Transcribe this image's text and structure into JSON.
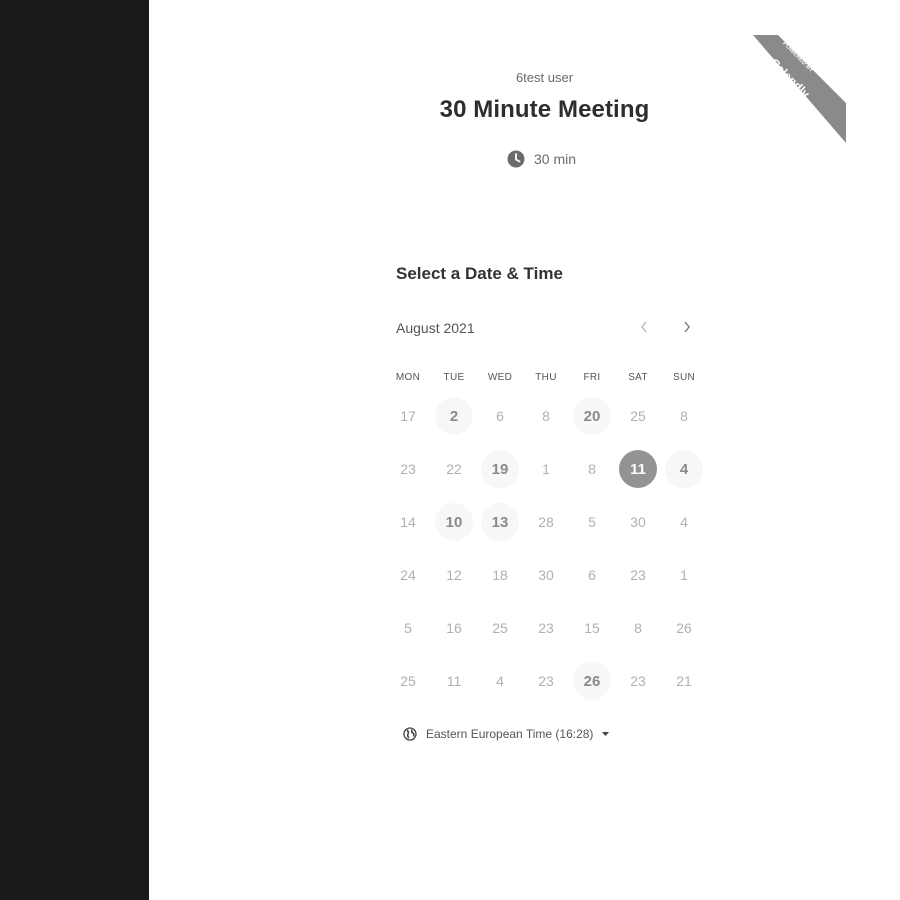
{
  "badge": {
    "line1": "POWERED BY",
    "line2": "Calendly"
  },
  "host": {
    "name": "6test user"
  },
  "event": {
    "title": "30 Minute Meeting",
    "duration": "30 min"
  },
  "section_title": "Select a Date & Time",
  "calendar": {
    "month": "August 2021",
    "weekdays": [
      "MON",
      "TUE",
      "WED",
      "THU",
      "FRI",
      "SAT",
      "SUN"
    ],
    "weeks": [
      [
        {
          "d": "17"
        },
        {
          "d": "2",
          "a": true
        },
        {
          "d": "6"
        },
        {
          "d": "8"
        },
        {
          "d": "20",
          "a": true
        },
        {
          "d": "25"
        },
        {
          "d": "8"
        }
      ],
      [
        {
          "d": "23"
        },
        {
          "d": "22"
        },
        {
          "d": "19",
          "a": true
        },
        {
          "d": "1"
        },
        {
          "d": "8"
        },
        {
          "d": "11",
          "s": true
        },
        {
          "d": "4",
          "a": true
        }
      ],
      [
        {
          "d": "14"
        },
        {
          "d": "10",
          "a": true
        },
        {
          "d": "13",
          "a": true
        },
        {
          "d": "28"
        },
        {
          "d": "5"
        },
        {
          "d": "30"
        },
        {
          "d": "4"
        }
      ],
      [
        {
          "d": "24"
        },
        {
          "d": "12"
        },
        {
          "d": "18"
        },
        {
          "d": "30"
        },
        {
          "d": "6"
        },
        {
          "d": "23"
        },
        {
          "d": "1"
        }
      ],
      [
        {
          "d": "5"
        },
        {
          "d": "16"
        },
        {
          "d": "25"
        },
        {
          "d": "23"
        },
        {
          "d": "15"
        },
        {
          "d": "8"
        },
        {
          "d": "26"
        }
      ],
      [
        {
          "d": "25"
        },
        {
          "d": "11"
        },
        {
          "d": "4"
        },
        {
          "d": "23"
        },
        {
          "d": "26",
          "a": true
        },
        {
          "d": "23"
        },
        {
          "d": "21"
        }
      ]
    ]
  },
  "timezone": {
    "label": "Eastern European Time (16:28)"
  },
  "icons": {
    "duration": "clock-icon",
    "timezone": "globe-icon",
    "prev": "chevron-left-icon",
    "next": "chevron-right-icon",
    "tz_dropdown": "caret-down-icon"
  },
  "colors": {
    "ribbon": "#8a8a8a",
    "selected_day": "#939393",
    "available_bg": "#f7f7f7",
    "sidebar": "#1a1a1a"
  }
}
